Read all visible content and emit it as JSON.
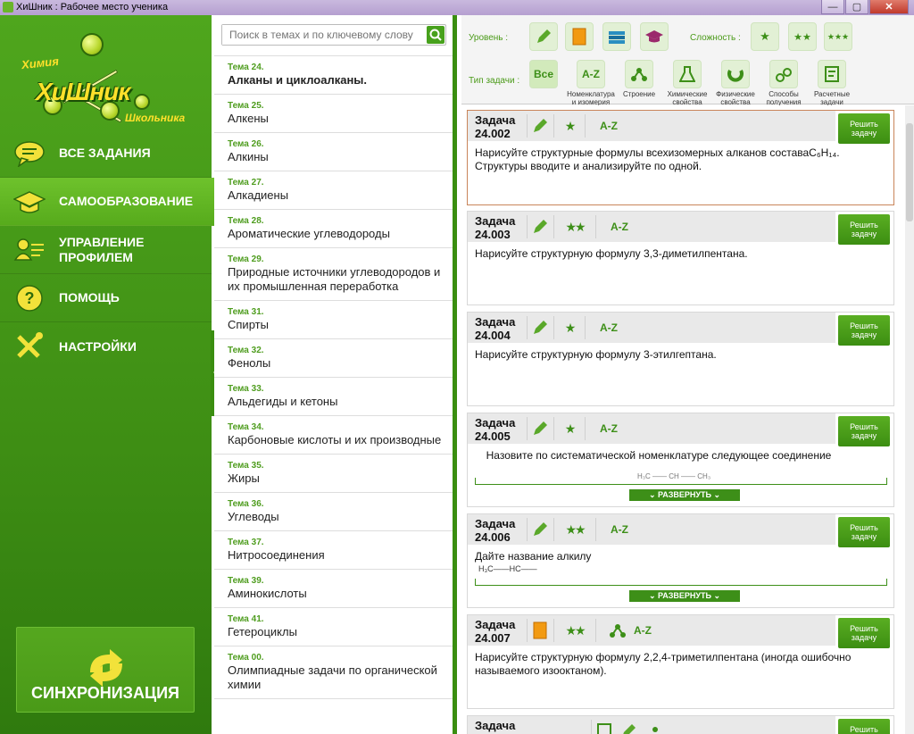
{
  "window": {
    "title": "ХиШник : Рабочее место ученика",
    "min": "—",
    "max": "▢",
    "close": "✕"
  },
  "logo": {
    "top": "Химия",
    "main": "ХиШник",
    "sub": "Школьника"
  },
  "menu": [
    {
      "label": "ВСЕ ЗАДАНИЯ",
      "icon": "chat-icon"
    },
    {
      "label": "САМООБРАЗОВАНИЕ",
      "icon": "graduation-cap-icon"
    },
    {
      "label": "УПРАВЛЕНИЕ ПРОФИЛЕМ",
      "icon": "profile-icon"
    },
    {
      "label": "ПОМОЩЬ",
      "icon": "help-icon"
    },
    {
      "label": "НАСТРОЙКИ",
      "icon": "tools-icon"
    }
  ],
  "sync": {
    "label": "СИНХРОНИЗАЦИЯ"
  },
  "search": {
    "placeholder": "Поиск в темах и по ключевому слову"
  },
  "topics": [
    {
      "num": "Тема 24.",
      "name": "Алканы и циклоалканы."
    },
    {
      "num": "Тема 25.",
      "name": "Алкены"
    },
    {
      "num": "Тема 26.",
      "name": "Алкины"
    },
    {
      "num": "Тема 27.",
      "name": "Алкадиены"
    },
    {
      "num": "Тема 28.",
      "name": "Ароматические углеводороды"
    },
    {
      "num": "Тема 29.",
      "name": "Природные источники углеводородов и их промышленная переработка"
    },
    {
      "num": "Тема 31.",
      "name": "Спирты"
    },
    {
      "num": "Тема 32.",
      "name": "Фенолы"
    },
    {
      "num": "Тема 33.",
      "name": "Альдегиды и кетоны"
    },
    {
      "num": "Тема 34.",
      "name": "Карбоновые кислоты и их производные"
    },
    {
      "num": "Тема 35.",
      "name": "Жиры"
    },
    {
      "num": "Тема 36.",
      "name": "Углеводы"
    },
    {
      "num": "Тема 37.",
      "name": "Нитросоединения"
    },
    {
      "num": "Тема 39.",
      "name": "Аминокислоты"
    },
    {
      "num": "Тема 41.",
      "name": "Гетероциклы"
    },
    {
      "num": "Тема 00.",
      "name": "Олимпиадные задачи по органической химии"
    }
  ],
  "filters": {
    "level_label": "Уровень :",
    "difficulty_label": "Сложность :",
    "type_label": "Тип задачи :",
    "all_label": "Все",
    "types": [
      {
        "cap": "Номенклатура и изомерия",
        "glyph": "A-Z"
      },
      {
        "cap": "Строение"
      },
      {
        "cap": "Химические свойства"
      },
      {
        "cap": "Физические свойства"
      },
      {
        "cap": "Способы получения"
      },
      {
        "cap": "Расчетные задачи"
      }
    ]
  },
  "tasks": [
    {
      "title": "Задача 24.002",
      "stars": "★",
      "type": "A-Z",
      "text": "Нарисуйте структурные формулы всехизомерных алканов составаC₆H₁₄. Структуры вводите и анализируйте по одной.",
      "solve": "Решить задачу"
    },
    {
      "title": "Задача 24.003",
      "stars": "★★",
      "type": "A-Z",
      "text": "Нарисуйте структурную формулу 3,3-диметилпентана.",
      "solve": "Решить задачу"
    },
    {
      "title": "Задача 24.004",
      "stars": "★",
      "type": "A-Z",
      "text": "Нарисуйте структурную формулу 3-этилгептана.",
      "solve": "Решить задачу"
    },
    {
      "title": "Задача 24.005",
      "stars": "★",
      "type": "A-Z",
      "text": "Назовите по систематической номенклатуре следующее соединение",
      "formula": "H₃C —— CH —— CH₃",
      "expand": "РАЗВЕРНУТЬ",
      "solve": "Решить задачу"
    },
    {
      "title": "Задача 24.006",
      "stars": "★★",
      "type": "A-Z",
      "text": "Дайте название алкилу",
      "formula": "H₃C——HC——",
      "expand": "РАЗВЕРНУТЬ",
      "solve": "Решить задачу"
    },
    {
      "title": "Задача 24.007",
      "stars": "★★",
      "type": "A-Z",
      "text": "Нарисуйте структурную формулу 2,2,4-триметилпентана (иногда ошибочно называемого изооктаном).",
      "solve": "Решить задачу"
    },
    {
      "title": "Задача",
      "solve": "Решить"
    }
  ]
}
